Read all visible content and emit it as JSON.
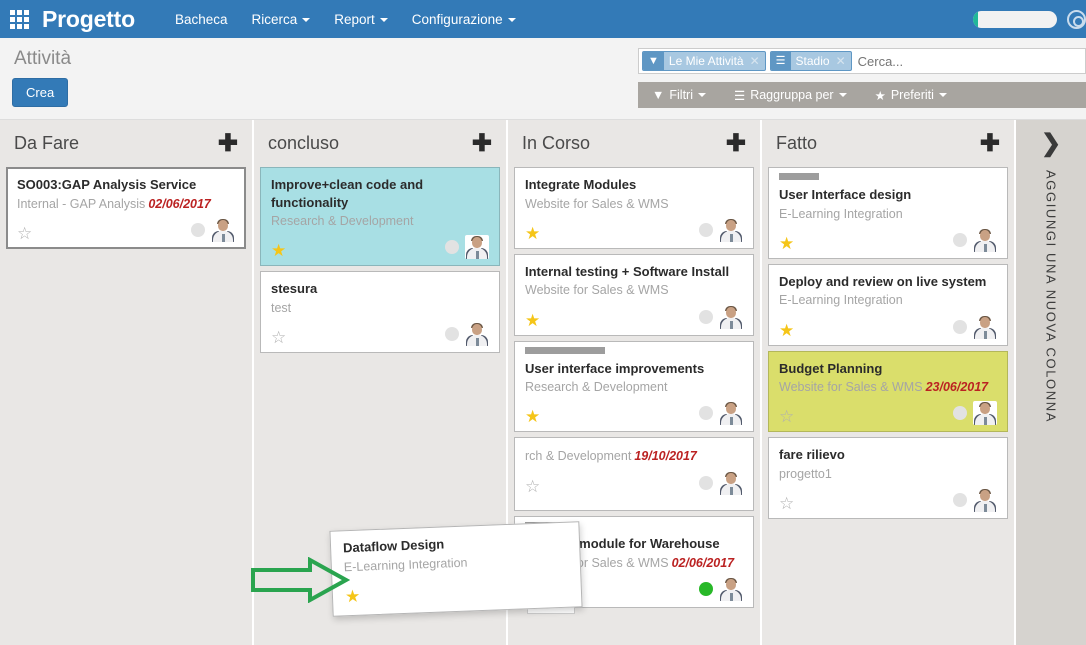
{
  "navbar": {
    "apps_icon": "apps-grid-icon",
    "brand": "Progetto",
    "menu": [
      {
        "label": "Bacheca",
        "caret": false
      },
      {
        "label": "Ricerca",
        "caret": true
      },
      {
        "label": "Report",
        "caret": true
      },
      {
        "label": "Configurazione",
        "caret": true
      }
    ]
  },
  "control_panel": {
    "title": "Attività",
    "create_label": "Crea",
    "search": {
      "placeholder": "Cerca...",
      "value": "",
      "facets": [
        {
          "icon": "filter-icon",
          "glyph": "▼",
          "label": "Le Mie Attività",
          "close": "✕"
        },
        {
          "icon": "group-by-icon",
          "glyph": "☰",
          "label": "Stadio",
          "close": "✕"
        }
      ]
    },
    "buttons": [
      {
        "icon": "filter-icon",
        "glyph": "▼",
        "label": "Filtri"
      },
      {
        "icon": "group-by-icon",
        "glyph": "☰",
        "label": "Raggruppa per"
      },
      {
        "icon": "star-icon",
        "glyph": "★",
        "label": "Preferiti"
      }
    ]
  },
  "board": {
    "add_column_label": "AGGIUNGI UNA NUOVA COLONNA",
    "add_column_chevron": "❯",
    "add_card_glyph": "✚",
    "columns": [
      {
        "title": "Da Fare",
        "cards": [
          {
            "title": "SO003:GAP Analysis Service",
            "subtitle": "Internal - GAP Analysis",
            "date": "02/06/2017",
            "starred": false,
            "color": "white",
            "selected": true,
            "tag": null,
            "dot": "grey"
          }
        ]
      },
      {
        "title": "concluso",
        "cards": [
          {
            "title": "Improve+clean code and functionality",
            "subtitle": "Research & Development",
            "date": "",
            "starred": true,
            "color": "teal",
            "selected": false,
            "tag": null,
            "dot": "grey"
          },
          {
            "title": "stesura",
            "subtitle": "test",
            "date": "",
            "starred": false,
            "color": "white",
            "selected": false,
            "tag": null,
            "dot": "grey"
          }
        ]
      },
      {
        "title": "In Corso",
        "cards": [
          {
            "title": "Integrate Modules",
            "subtitle": "Website for Sales & WMS",
            "date": "",
            "starred": true,
            "color": "white",
            "selected": false,
            "tag": null,
            "dot": "grey"
          },
          {
            "title": "Internal testing + Software Install",
            "subtitle": "Website for Sales & WMS",
            "date": "",
            "starred": true,
            "color": "white",
            "selected": false,
            "tag": null,
            "dot": "grey"
          },
          {
            "title": "User interface improvements",
            "subtitle": "Research & Development",
            "date": "",
            "starred": true,
            "color": "white",
            "selected": false,
            "tag": "long",
            "dot": "grey"
          },
          {
            "title": "",
            "subtitle": "rch & Development",
            "date": "19/10/2017",
            "starred": false,
            "color": "white",
            "selected": false,
            "tag": null,
            "dot": "grey"
          },
          {
            "title": "Develop module for Warehouse",
            "subtitle": "Website for Sales & WMS",
            "date": "02/06/2017",
            "starred": false,
            "color": "white",
            "selected": false,
            "tag": "short",
            "dot": "green"
          }
        ]
      },
      {
        "title": "Fatto",
        "cards": [
          {
            "title": "User Interface design",
            "subtitle": "E-Learning Integration",
            "date": "",
            "starred": true,
            "color": "white",
            "selected": false,
            "tag": "short",
            "dot": "grey"
          },
          {
            "title": "Deploy and review on live system",
            "subtitle": "E-Learning Integration",
            "date": "",
            "starred": true,
            "color": "white",
            "selected": false,
            "tag": null,
            "dot": "grey"
          },
          {
            "title": "Budget Planning",
            "subtitle": "Website for Sales & WMS",
            "date": "23/06/2017",
            "starred": false,
            "color": "yellow",
            "selected": false,
            "tag": null,
            "dot": "grey"
          },
          {
            "title": "fare rilievo",
            "subtitle": "progetto1",
            "date": "",
            "starred": false,
            "color": "white",
            "selected": false,
            "tag": null,
            "dot": "grey"
          }
        ]
      }
    ],
    "dragged_card": {
      "title": "Dataflow Design",
      "subtitle": "E-Learning Integration",
      "starred": true
    },
    "annotation": {
      "type": "arrow-right",
      "color": "#2aa44f"
    }
  },
  "colors": {
    "navbar": "#337ab7",
    "accent": "#337ab7",
    "filter_bar": "#a8a5a0",
    "column_bg": "#e9e7e5",
    "card_teal": "#a8dfe4",
    "card_yellow": "#dade6b",
    "date_red": "#bb2222",
    "star_on": "#f5c518",
    "dot_green": "#28b828",
    "annotation_green": "#2aa44f"
  }
}
